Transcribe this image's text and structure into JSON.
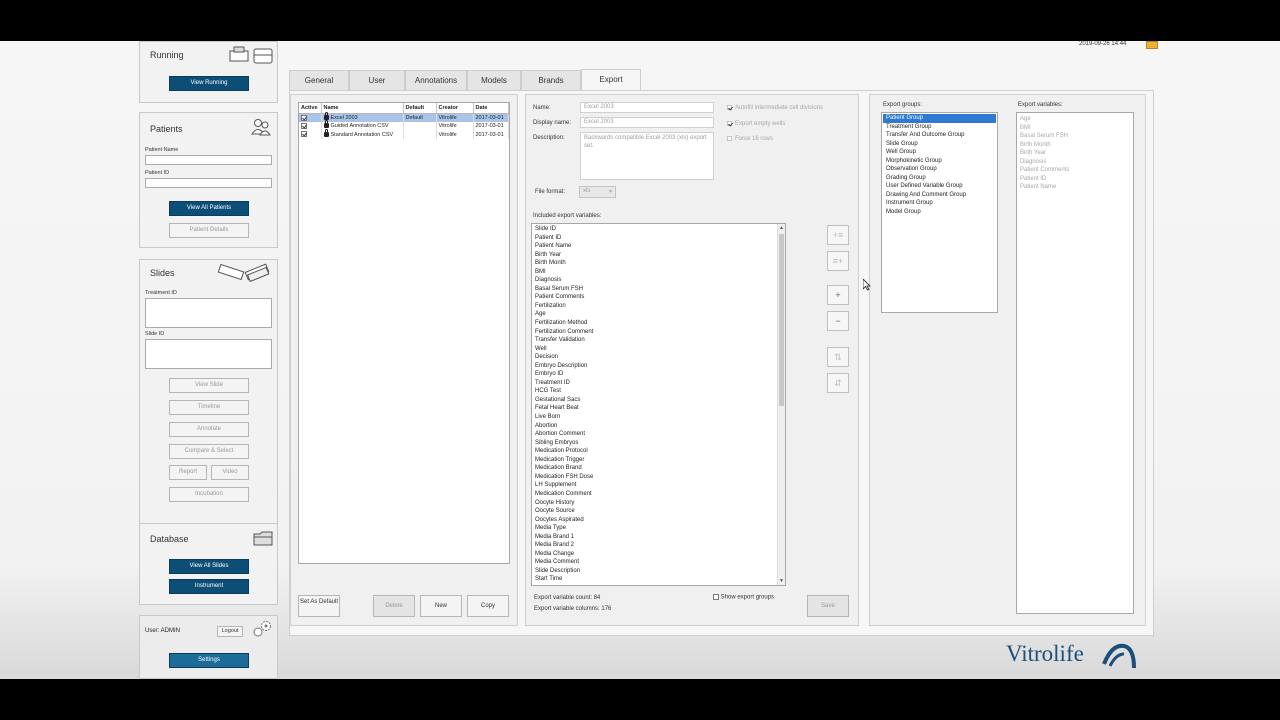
{
  "system": {
    "datetime": "2019-09-26 14:44"
  },
  "sidebar": {
    "running": {
      "title": "Running",
      "view_button": "View Running"
    },
    "patients": {
      "title": "Patients",
      "name_label": "Patient Name",
      "id_label": "Patient ID",
      "view_all_button": "View All Patients",
      "details_button": "Patient Details"
    },
    "slides": {
      "title": "Slides",
      "treatment_label": "Treatment ID",
      "slide_label": "Slide ID",
      "buttons": {
        "view_slide": "View Slide",
        "timeline": "Timeline",
        "annotate": "Annotate",
        "compare": "Compare & Select",
        "report": "Report",
        "video": "Video",
        "incubation": "Incubation"
      }
    },
    "database": {
      "title": "Database",
      "view_all_slides": "View All Slides",
      "instrument": "Instrument"
    },
    "user": {
      "label": "User: ADMIN",
      "logout": "Logout",
      "settings": "Settings"
    }
  },
  "tabs": [
    {
      "label": "General",
      "active": false
    },
    {
      "label": "User",
      "active": false
    },
    {
      "label": "Annotations",
      "active": false
    },
    {
      "label": "Models",
      "active": false
    },
    {
      "label": "Brands",
      "active": false
    },
    {
      "label": "Export",
      "active": true
    }
  ],
  "export_sets": {
    "columns": [
      "Active",
      "Name",
      "Default",
      "Creator",
      "Date"
    ],
    "rows": [
      {
        "name": "Excel 2003",
        "default": "Default",
        "creator": "Vitrolife",
        "date": "2017-03-01",
        "selected": true
      },
      {
        "name": "Guided Annotation CSV",
        "default": "",
        "creator": "Vitrolife",
        "date": "2017-03-01",
        "selected": false
      },
      {
        "name": "Standard Annotation CSV",
        "default": "",
        "creator": "Vitrolife",
        "date": "2017-03-01",
        "selected": false
      }
    ],
    "buttons": {
      "set_default": "Set As Default",
      "delete": "Delete",
      "new": "New",
      "copy": "Copy"
    }
  },
  "details": {
    "name_label": "Name:",
    "name_value": "Excel 2003",
    "display_label": "Display name:",
    "display_value": "Excel 2003",
    "desc_label": "Description:",
    "desc_value": "Backwards compatible Excel 2003 (xls) export set.",
    "format_label": "File format:",
    "format_value": "xls",
    "options": {
      "autofill": "Autofill intermediate cell divisions",
      "empty_wells": "Export empty wells",
      "force_rows": "Force 16 rows"
    },
    "included_label": "Included export variables:",
    "variables": [
      "Slide ID",
      "Patient ID",
      "Patient Name",
      "Birth Year",
      "Birth Month",
      "BMI",
      "Diagnosis",
      "Basal Serum FSH",
      "Patient Comments",
      "Fertilization",
      "Age",
      "Fertilization Method",
      "Fertilization Comment",
      "Transfer Validation",
      "Well",
      "Decision",
      "Embryo Description",
      "Embryo ID",
      "Treatment ID",
      "HCG Test",
      "Gestational Sacs",
      "Fetal Heart Beat",
      "Live Born",
      "Abortion",
      "Abortion Comment",
      "Sibling Embryos",
      "Medication Protocol",
      "Medication Trigger",
      "Medication Brand",
      "Medication FSH Dose",
      "LH Supplement",
      "Medication Comment",
      "Oocyte History",
      "Oocyte Source",
      "Oocytes Aspirated",
      "Media Type",
      "Media Brand 1",
      "Media Brand 2",
      "Media Change",
      "Media Comment",
      "Slide Description",
      "Start Time"
    ],
    "count_label": "Export variable count: 84",
    "columns_label": "Export variable columns: 176",
    "show_groups": "Show export groups",
    "save": "Save",
    "side_buttons": [
      "+≡",
      "≡+",
      "+",
      "−",
      "⇅",
      "⇵"
    ]
  },
  "groups": {
    "groups_label": "Export groups:",
    "vars_label": "Export variables:",
    "items": [
      "Patient Group",
      "Treatment Group",
      "Transfer And Outcome Group",
      "Slide Group",
      "Well Group",
      "Morphokinetic Group",
      "Observation Group",
      "Grading Group",
      "User Defined Variable Group",
      "Drawing And Comment Group",
      "Instrument Group",
      "Model Group"
    ],
    "variables": [
      "Age",
      "BMI",
      "Basal Serum FSH",
      "Birth Month",
      "Birth Year",
      "Diagnosis",
      "Patient Comments",
      "Patient ID",
      "Patient Name"
    ]
  },
  "brand": {
    "logo_text": "Vitrolife"
  },
  "colors": {
    "accent": "#0d4e77",
    "selection": "#2f78d3",
    "row_selection": "#a9c4e8"
  }
}
